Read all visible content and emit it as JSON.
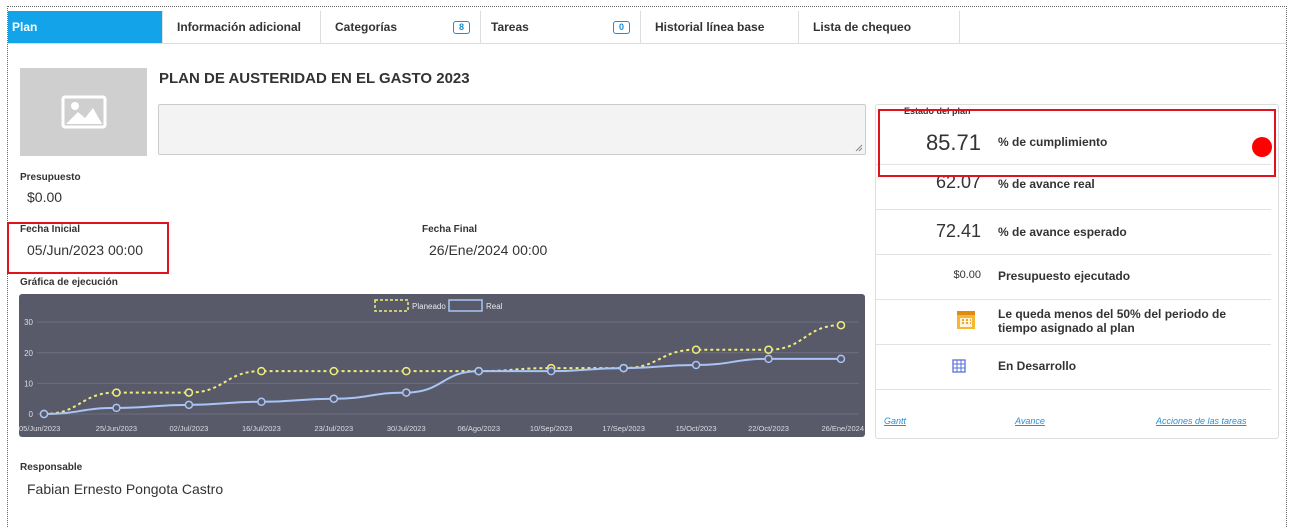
{
  "tabs": [
    {
      "label": "Plan"
    },
    {
      "label": "Información adicional"
    },
    {
      "label": "Categorías",
      "badge": "8"
    },
    {
      "label": "Tareas",
      "badge": "0"
    },
    {
      "label": "Historial línea base"
    },
    {
      "label": "Lista de chequeo"
    }
  ],
  "plan": {
    "title": "PLAN DE AUSTERIDAD EN EL GASTO 2023",
    "description": "",
    "budget_label": "Presupuesto",
    "budget_value": "$0.00",
    "start_label": "Fecha Inicial",
    "start_value": "05/Jun/2023 00:00",
    "end_label": "Fecha Final",
    "end_value": "26/Ene/2024 00:00",
    "chart_label": "Gráfica de ejecución",
    "responsible_label": "Responsable",
    "responsible_value": "Fabian Ernesto Pongota Castro"
  },
  "status": {
    "header": "Estado del plan",
    "rows": [
      {
        "value": "85.71",
        "label": "% de cumplimiento"
      },
      {
        "value": "62.07",
        "label": "% de avance real"
      },
      {
        "value": "72.41",
        "label": "% de avance esperado"
      },
      {
        "value": "$0.00",
        "label": "Presupuesto ejecutado"
      }
    ],
    "time_notice": "Le queda menos del 50% del periodo de tiempo asignado al plan",
    "state": "En Desarrollo",
    "indicator_color": "#ff0000",
    "links": {
      "gantt": "Gantt",
      "avance": "Avance",
      "acciones": "Acciones de las tareas"
    }
  },
  "chart_data": {
    "type": "line",
    "categories": [
      "05/Jun/2023",
      "25/Jun/2023",
      "02/Jul/2023",
      "16/Jul/2023",
      "23/Jul/2023",
      "30/Jul/2023",
      "06/Ago/2023",
      "10/Sep/2023",
      "17/Sep/2023",
      "15/Oct/2023",
      "22/Oct/2023",
      "26/Ene/2024"
    ],
    "series": [
      {
        "name": "Planeado",
        "color": "#f0ee7a",
        "dashed": true,
        "values": [
          0,
          7,
          7,
          14,
          14,
          14,
          14,
          15,
          15,
          21,
          21,
          29
        ]
      },
      {
        "name": "Real",
        "color": "#a9c4f5",
        "dashed": false,
        "values": [
          0,
          2,
          3,
          4,
          5,
          7,
          14,
          14,
          15,
          16,
          18,
          18
        ]
      }
    ],
    "yticks": [
      0,
      10,
      20,
      30
    ],
    "ylim": [
      0,
      32
    ],
    "grid": true,
    "legend": "top-center",
    "background": "#585a6a"
  }
}
